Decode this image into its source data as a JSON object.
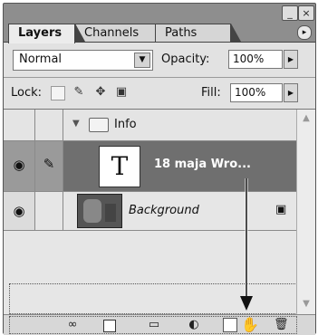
{
  "tabs": [
    "Layers",
    "Channels",
    "Paths"
  ],
  "window": {
    "minimize": "_",
    "close": "×",
    "panel_menu": "▸"
  },
  "blend_mode": {
    "value": "Normal"
  },
  "opacity": {
    "label": "Opacity:",
    "value": "100%"
  },
  "lock": {
    "label": "Lock:"
  },
  "fill": {
    "label": "Fill:",
    "value": "100%"
  },
  "layers": [
    {
      "name": "Info",
      "type": "group"
    },
    {
      "name": "18 maja Wro...",
      "type": "text",
      "thumb": "T",
      "selected": true
    },
    {
      "name": "Background",
      "type": "image",
      "locked": true
    }
  ],
  "icons": {
    "eye": "eye-icon",
    "brush": "brush-icon",
    "folder": "folder-icon",
    "lock": "lock-icon",
    "link": "link-layers-icon",
    "mask": "add-mask-icon",
    "adjust": "adjustment-layer-icon",
    "new_group": "new-group-icon",
    "new_layer": "new-layer-icon",
    "trash": "trash-icon",
    "cursor": "hand-cursor-icon"
  },
  "colors": {
    "selected_row": "#6f6f6f",
    "panel_bg": "#e2e2e2",
    "tab_bar": "#8e8e8e"
  }
}
